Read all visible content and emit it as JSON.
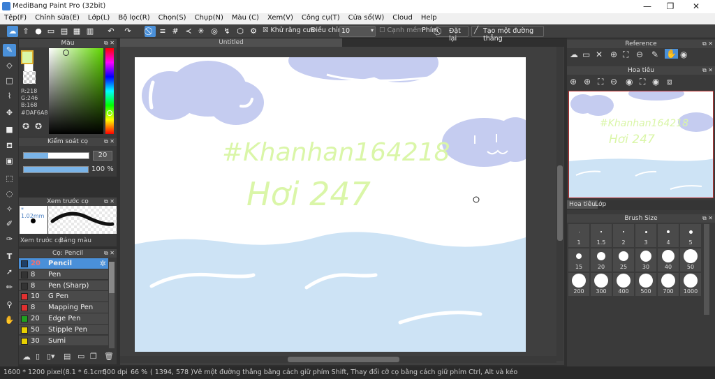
{
  "window": {
    "title": "MediBang Paint Pro (32bit)",
    "min": "—",
    "max": "❐",
    "close": "✕"
  },
  "menu": [
    "Tệp(F)",
    "Chỉnh sửa(E)",
    "Lớp(L)",
    "Bộ lọc(R)",
    "Chọn(S)",
    "Chụp(N)",
    "Màu (C)",
    "Xem(V)",
    "Công cụ(T)",
    "Cửa sổ(W)",
    "Cloud",
    "Help"
  ],
  "toolbar": {
    "antialias": "Khử răng cưa",
    "correction_label": "Điều chỉnh",
    "correction_value": "10",
    "soft_edge": "Cạnh mềm",
    "key_label": "Phím",
    "reset": "Đặt lại",
    "straight_line": "Tạo một đường thẳng"
  },
  "document": {
    "tab": "Untitled"
  },
  "color_panel": {
    "title": "Màu",
    "r": "R:218",
    "g": "G:246",
    "b": "B:168",
    "hex": "#DAF6A8",
    "fg": "#DAF6A8"
  },
  "brush_control": {
    "title": "Kiểm soát cọ",
    "size": "20",
    "opacity": "100 %",
    "opacity_value": 100
  },
  "brush_preview": {
    "title": "Xem trước cọ",
    "size_text": "* 1.02mm",
    "tab1": "Xem trước cọ",
    "tab2": "Bảng màu"
  },
  "brush_list": {
    "title": "Cọ: Pencil",
    "items": [
      {
        "size": "20",
        "name": "Pencil",
        "color": "#3a6ea8"
      },
      {
        "size": "8",
        "name": "Pen",
        "color": "#333333"
      },
      {
        "size": "8",
        "name": "Pen (Sharp)",
        "color": "#333333"
      },
      {
        "size": "10",
        "name": "G Pen",
        "color": "#e03030"
      },
      {
        "size": "8",
        "name": "Mapping Pen",
        "color": "#e03030"
      },
      {
        "size": "20",
        "name": "Edge Pen",
        "color": "#20a020"
      },
      {
        "size": "50",
        "name": "Stipple Pen",
        "color": "#e8d000"
      },
      {
        "size": "30",
        "name": "Sumi",
        "color": "#e8d000"
      }
    ]
  },
  "artwork": {
    "text1": "#Khanhan164218",
    "text2": "Hơi 247",
    "text_color": "#DAF6A8",
    "cloud_color": "#c5ccf0",
    "water_color": "#cde3f5"
  },
  "right": {
    "reference": "Reference",
    "navigator": "Hoa tiêu",
    "tab_nav": "Hoa tiêu",
    "tab_layer": "Lớp",
    "brush_size_title": "Brush Size",
    "sizes": [
      "1",
      "1.5",
      "2",
      "3",
      "4",
      "5",
      "15",
      "20",
      "25",
      "30",
      "40",
      "50",
      "200",
      "300",
      "400",
      "500",
      "700",
      "1000"
    ]
  },
  "status": {
    "size": "1600 * 1200 pixel",
    "cm": "(8.1 * 6.1cm)",
    "dpi": "500 dpi",
    "zoom": "66 %",
    "coords": "( 1394, 578 )",
    "hint": "Vẽ một đường thẳng bằng cách giữ phím Shift, Thay đổi cỡ cọ bằng cách giữ phím Ctrl, Alt và kéo"
  }
}
